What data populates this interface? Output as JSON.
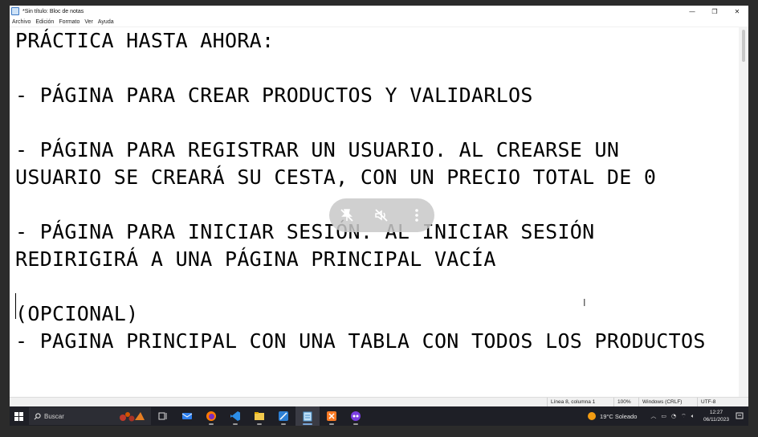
{
  "window": {
    "title": "*Sin título: Bloc de notas",
    "controls": {
      "minimize": "—",
      "maximize": "❐",
      "close": "✕"
    }
  },
  "menu": [
    "Archivo",
    "Edición",
    "Formato",
    "Ver",
    "Ayuda"
  ],
  "editor": {
    "lines": [
      "PRÁCTICA HASTA AHORA:",
      "",
      "- PÁGINA PARA CREAR PRODUCTOS Y VALIDARLOS",
      "",
      "- PÁGINA PARA REGISTRAR UN USUARIO. AL CREARSE UN",
      "USUARIO SE CREARÁ SU CESTA, CON UN PRECIO TOTAL DE 0",
      "",
      "- PÁGINA PARA INICIAR SESIÓN. AL INICIAR SESIÓN",
      "REDIRIGIRÁ A UNA PÁGINA PRINCIPAL VACÍA",
      "",
      "(OPCIONAL)",
      "- PAGINA PRINCIPAL CON UNA TABLA CON TODOS LOS PRODUCTOS"
    ]
  },
  "status": {
    "position": "Línea 8, columna 1",
    "zoom": "100%",
    "line_endings": "Windows (CRLF)",
    "encoding": "UTF-8"
  },
  "taskbar": {
    "search_placeholder": "Buscar",
    "apps": [
      "task-view-icon",
      "mail-icon",
      "firefox-icon",
      "vscode-icon",
      "file-explorer-icon",
      "snipping-tool-icon",
      "notepad-icon",
      "xampp-icon",
      "app-icon"
    ],
    "weather": "19°C  Soleado",
    "time": "12:27",
    "date": "06/11/2023"
  }
}
